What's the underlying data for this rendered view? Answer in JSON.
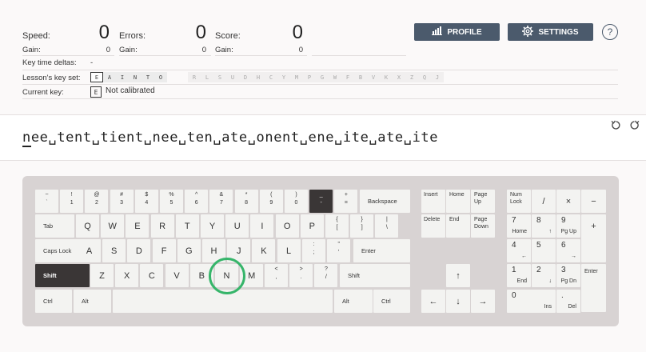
{
  "stats": {
    "speed_label": "Speed:",
    "speed_value": "0",
    "errors_label": "Errors:",
    "errors_value": "0",
    "score_label": "Score:",
    "score_value": "0",
    "gain_label": "Gain:",
    "speed_gain": "0",
    "errors_gain": "0",
    "score_gain": "0"
  },
  "header": {
    "profile_label": "PROFILE",
    "settings_label": "SETTINGS",
    "help_label": "?"
  },
  "info": {
    "key_deltas_label": "Key time deltas:",
    "key_deltas_value": "-",
    "keyset_label": "Lesson's key set:",
    "keyset_active": [
      "E",
      "A",
      "I",
      "N",
      "T",
      "O"
    ],
    "keyset_inactive": [
      "R",
      "L",
      "S",
      "U",
      "D",
      "H",
      "C",
      "Y",
      "M",
      "P",
      "G",
      "W",
      "F",
      "B",
      "V",
      "K",
      "X",
      "Z",
      "Q",
      "J"
    ],
    "current_key_label": "Current key:",
    "current_key": "E",
    "current_key_status": "Not calibrated"
  },
  "lesson": {
    "typed": "n",
    "rest": "ee␣tent␣tient␣nee␣ten␣ate␣onent␣ene␣ite␣ate␣ite"
  },
  "keyboard": {
    "row1": [
      {
        "t": "~",
        "b": "`"
      },
      {
        "t": "!",
        "b": "1"
      },
      {
        "t": "@",
        "b": "2"
      },
      {
        "t": "#",
        "b": "3"
      },
      {
        "t": "$",
        "b": "4"
      },
      {
        "t": "%",
        "b": "5"
      },
      {
        "t": "^",
        "b": "6"
      },
      {
        "t": "&",
        "b": "7"
      },
      {
        "t": "*",
        "b": "8"
      },
      {
        "t": "(",
        "b": "9"
      },
      {
        "t": ")",
        "b": "0"
      },
      {
        "t": "_",
        "b": "-"
      },
      {
        "t": "+",
        "b": "="
      }
    ],
    "backspace": "Backspace",
    "tab": "Tab",
    "row2": [
      "Q",
      "W",
      "E",
      "R",
      "T",
      "Y",
      "U",
      "I",
      "O",
      "P"
    ],
    "row2_sym": [
      {
        "t": "{",
        "b": "["
      },
      {
        "t": "}",
        "b": "]"
      },
      {
        "t": "|",
        "b": "\\"
      }
    ],
    "caps": "Caps Lock",
    "row3": [
      "A",
      "S",
      "D",
      "F",
      "G",
      "H",
      "J",
      "K",
      "L"
    ],
    "row3_sym": [
      {
        "t": ":",
        "b": ";"
      },
      {
        "t": "\"",
        "b": "'"
      }
    ],
    "enter": "Enter",
    "shift_left": "Shift",
    "row4": [
      "Z",
      "X",
      "C",
      "V",
      "B",
      "N",
      "M"
    ],
    "row4_sym": [
      {
        "t": "<",
        "b": ","
      },
      {
        "t": ">",
        "b": "."
      },
      {
        "t": "?",
        "b": "/"
      }
    ],
    "shift_right": "Shift",
    "ctrl": "Ctrl",
    "alt": "Alt",
    "nav": {
      "insert": "Insert",
      "home": "Home",
      "pgup": [
        "Page",
        "Up"
      ],
      "delete": "Delete",
      "end": "End",
      "pgdn": [
        "Page",
        "Down"
      ]
    },
    "arrows": {
      "up": "↑",
      "left": "←",
      "down": "↓",
      "right": "→"
    },
    "numpad": {
      "numlock": [
        "Num",
        "Lock"
      ],
      "div": "/",
      "mul": "×",
      "minus": "−",
      "plus": "+",
      "enter": "Enter",
      "n7": [
        "7",
        "Home"
      ],
      "n8": [
        "8",
        "↑"
      ],
      "n9": [
        "9",
        "Pg Up"
      ],
      "n4": [
        "4",
        "←"
      ],
      "n5": "5",
      "n6": [
        "6",
        "→"
      ],
      "n1": [
        "1",
        "End"
      ],
      "n2": [
        "2",
        "↓"
      ],
      "n3": [
        "3",
        "Pg Dn"
      ],
      "n0": [
        "0",
        "Ins"
      ],
      "dot": [
        ".",
        "Del"
      ]
    }
  }
}
